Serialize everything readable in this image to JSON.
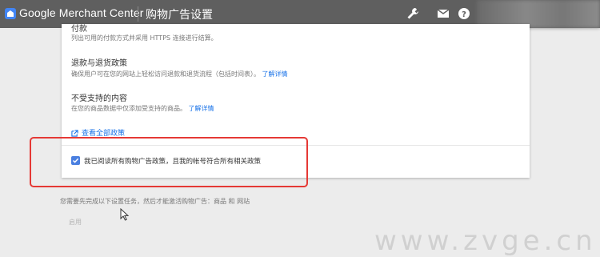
{
  "header": {
    "brand": "Google Merchant Center",
    "page_title": "购物广告设置"
  },
  "card": {
    "payment_title": "付款",
    "payment_desc": "列出可用的付款方式并采用 HTTPS 连接进行结算。",
    "refund_title": "退款与退货政策",
    "refund_desc": "确保用户可在您的网站上轻松访问退款和退货流程（包括时间表）。",
    "refund_link": "了解详情",
    "unsupported_title": "不受支持的内容",
    "unsupported_desc": "在您的商品数据中仅添加受支持的商品。",
    "unsupported_link": "了解详情",
    "all_policies_link": "查看全部政策",
    "agreement_label": "我已阅读所有购物广告政策，且我的帐号符合所有相关政策",
    "agreement_checked": true
  },
  "footer": {
    "note": "您需要先完成以下设置任务，然后才能激活购物广告：商品 和 网站",
    "enable_button": "启用"
  },
  "watermark": "www.zvge.cn",
  "colors": {
    "topbar": "#5f5f5f",
    "accent": "#1a73e8",
    "checkbox": "#4a7fe0",
    "highlight": "#e53935"
  }
}
